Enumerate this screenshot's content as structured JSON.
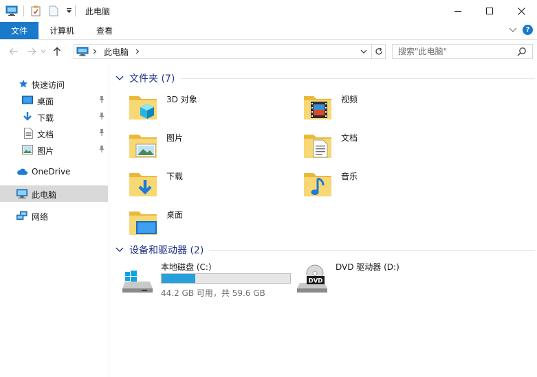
{
  "window": {
    "title": "此电脑"
  },
  "ribbon": {
    "tabs": [
      "文件",
      "计算机",
      "查看"
    ]
  },
  "address": {
    "crumb": "此电脑"
  },
  "search": {
    "placeholder": "搜索\"此电脑\""
  },
  "sidebar": {
    "quick_access": "快速访问",
    "quick_items": [
      "桌面",
      "下载",
      "文档",
      "图片"
    ],
    "onedrive": "OneDrive",
    "this_pc": "此电脑",
    "network": "网络"
  },
  "folders": {
    "header": "文件夹 (7)",
    "items": [
      "3D 对象",
      "视频",
      "图片",
      "文档",
      "下载",
      "音乐",
      "桌面"
    ]
  },
  "drives": {
    "header": "设备和驱动器 (2)",
    "items": [
      {
        "name": "本地磁盘 (C:)",
        "info": "44.2 GB 可用，共 59.6 GB",
        "used_fraction": 0.26
      },
      {
        "name": "DVD 驱动器 (D:)"
      }
    ]
  },
  "icons": {
    "accent": "#1979ca",
    "folder": "#f8d775",
    "progress": "#26a0da"
  }
}
